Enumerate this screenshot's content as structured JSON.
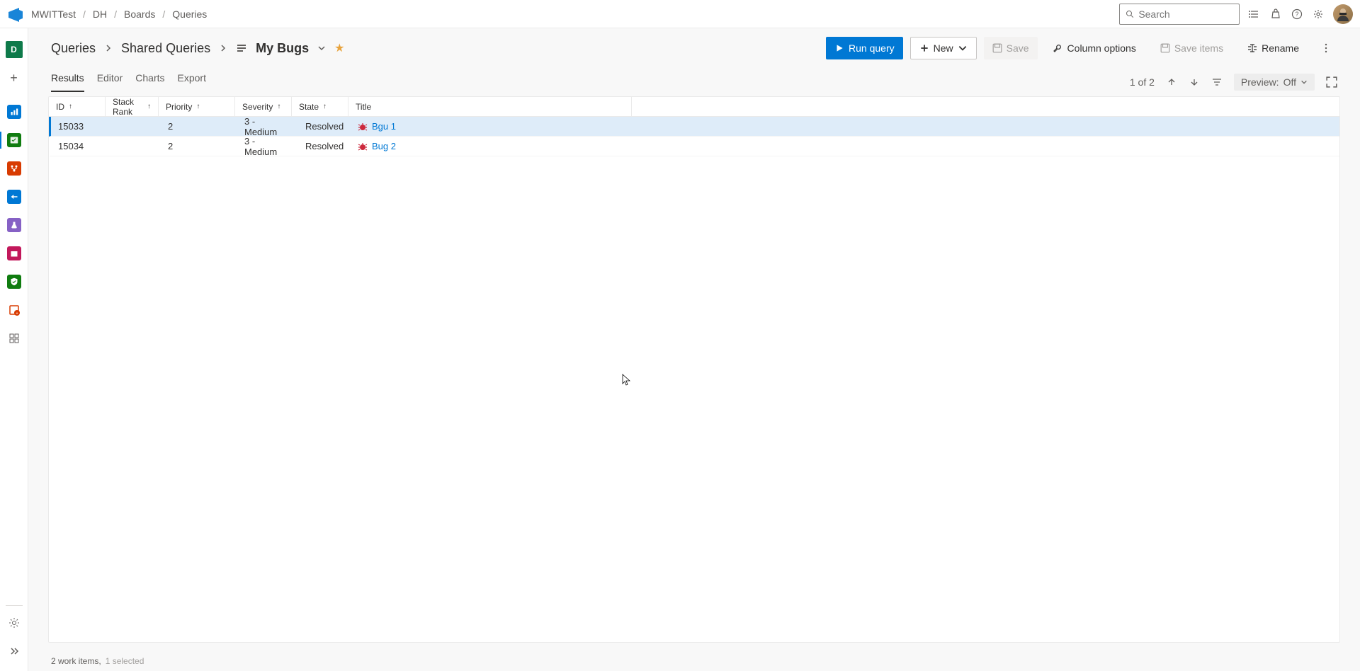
{
  "breadcrumb": {
    "org": "MWITTest",
    "project": "DH",
    "section": "Boards",
    "page": "Queries"
  },
  "search": {
    "placeholder": "Search"
  },
  "project_initial": "D",
  "page": {
    "level1": "Queries",
    "level2": "Shared Queries",
    "name": "My Bugs"
  },
  "actions": {
    "run": "Run query",
    "new": "New",
    "save": "Save",
    "column_options": "Column options",
    "save_items": "Save items",
    "rename": "Rename"
  },
  "tabs": [
    "Results",
    "Editor",
    "Charts",
    "Export"
  ],
  "active_tab": "Results",
  "paging": {
    "text": "1 of 2"
  },
  "preview": {
    "label": "Preview:",
    "value": "Off"
  },
  "columns": {
    "id": "ID",
    "stack_rank": "Stack Rank",
    "priority": "Priority",
    "severity": "Severity",
    "state": "State",
    "title": "Title"
  },
  "rows": [
    {
      "id": "15033",
      "stack_rank": "",
      "priority": "2",
      "severity": "3 - Medium",
      "state": "Resolved",
      "title": "Bgu 1",
      "selected": true
    },
    {
      "id": "15034",
      "stack_rank": "",
      "priority": "2",
      "severity": "3 - Medium",
      "state": "Resolved",
      "title": "Bug 2",
      "selected": false
    }
  ],
  "status": {
    "work_items": "2 work items,",
    "selected": "1 selected"
  }
}
